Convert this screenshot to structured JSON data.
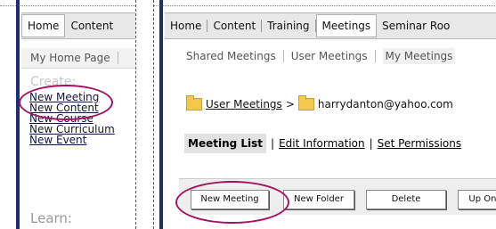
{
  "left_panel": {
    "nav_tabs": [
      "Home",
      "Content"
    ],
    "sub_nav": [
      "My Home Page"
    ],
    "create_heading": "Create:",
    "create_links": [
      "New Meeting",
      "New Content",
      "New Course",
      "New Curriculum",
      "New Event"
    ],
    "learn_heading": "Learn:"
  },
  "right_panel": {
    "nav_tabs": [
      "Home",
      "Content",
      "Training",
      "Meetings",
      "Seminar Roo"
    ],
    "active_tab": "Meetings",
    "sub_nav": [
      "Shared Meetings",
      "User Meetings",
      "My Meetings"
    ],
    "breadcrumb": {
      "link": "User Meetings",
      "separator": ">",
      "current": "harrydanton@yahoo.com"
    },
    "page_tabs": [
      "Meeting List",
      "Edit Information",
      "Set Permissions"
    ],
    "page_tab_separator": "|",
    "toolbar_buttons": [
      "New Meeting",
      "New Folder",
      "Delete",
      "Up One"
    ]
  },
  "colors": {
    "highlight_circle": "#a0145f",
    "sidebar_bar": "#1e2f6b"
  }
}
